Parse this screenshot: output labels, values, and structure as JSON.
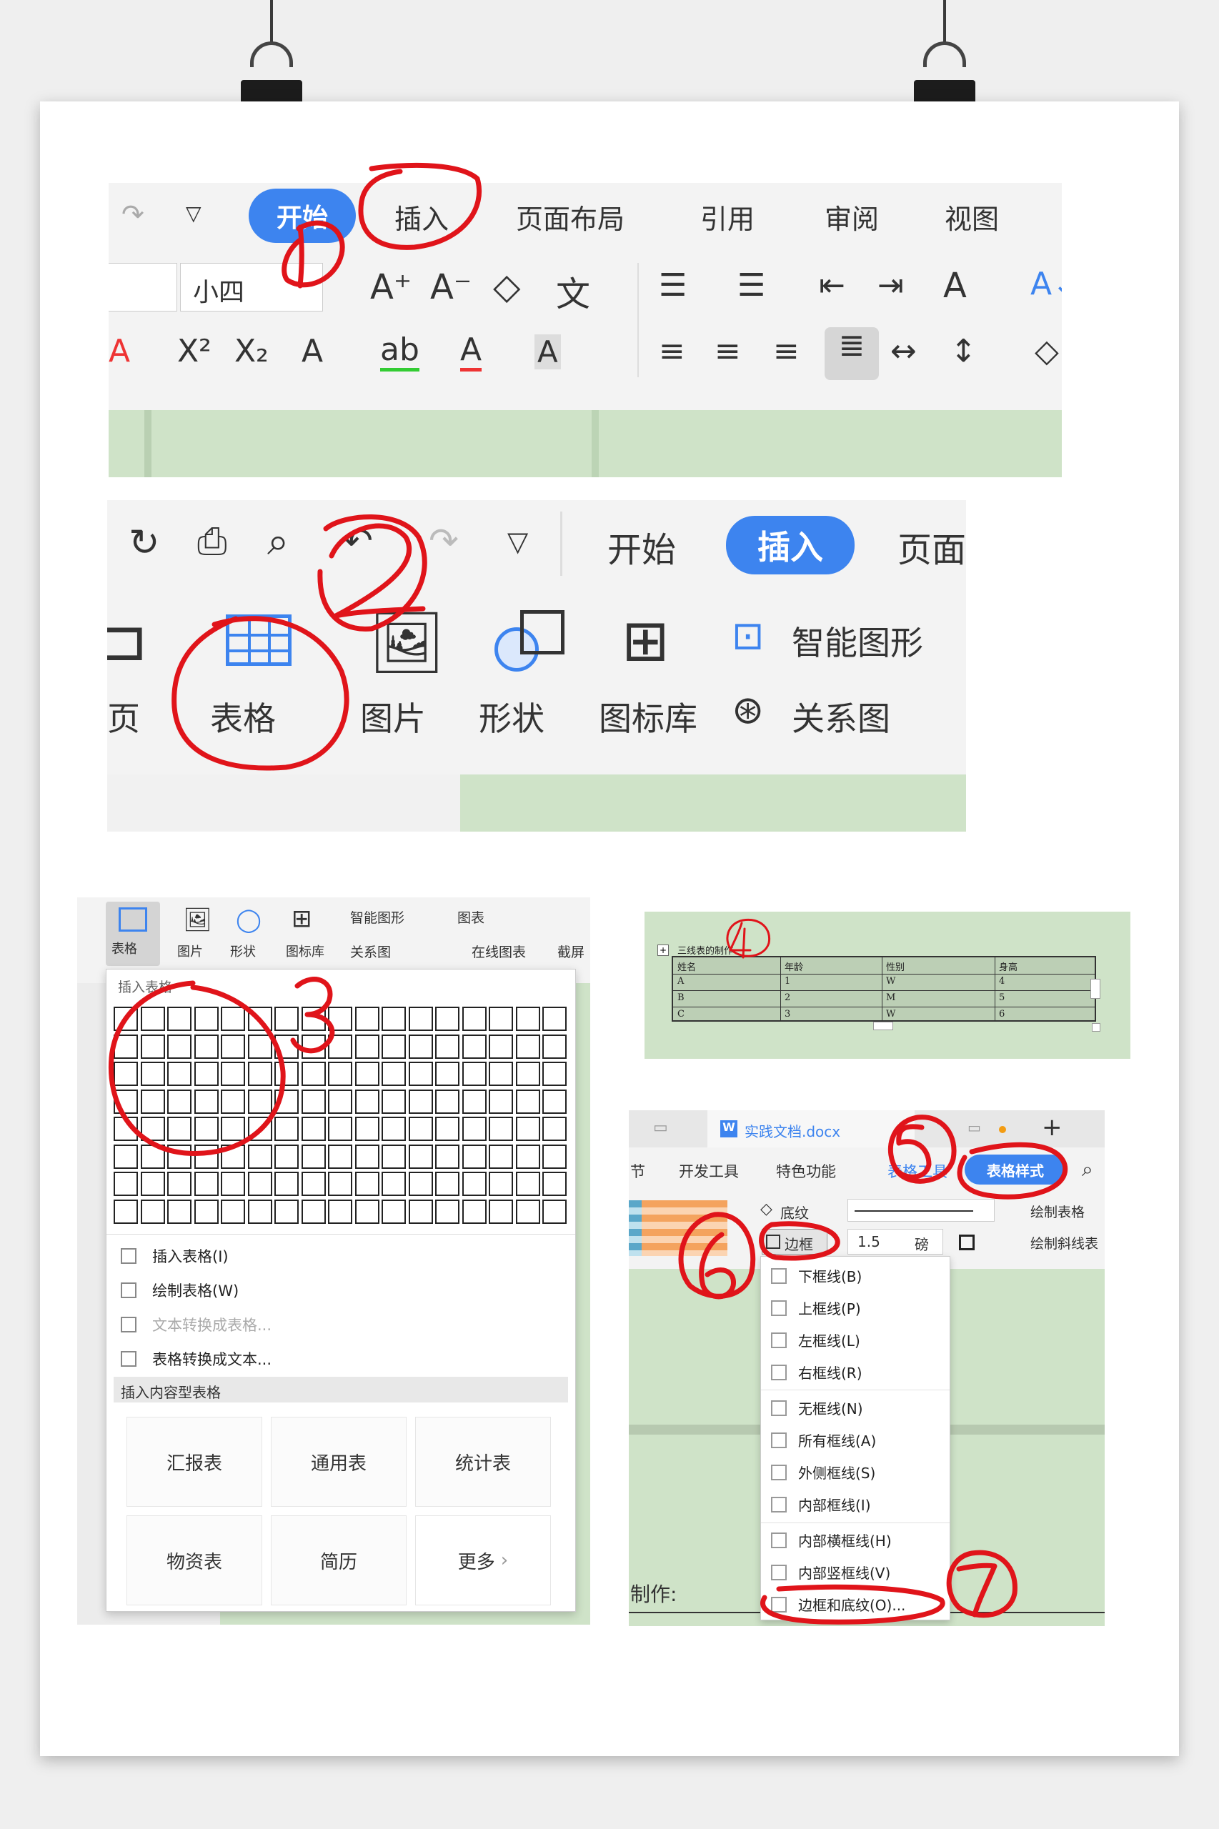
{
  "step1": {
    "tabs": [
      "开始",
      "插入",
      "页面布局",
      "引用",
      "审阅",
      "视图"
    ],
    "font_size": "小四",
    "markers": [
      "1"
    ]
  },
  "step2": {
    "tabs": [
      "开始",
      "插入",
      "页面"
    ],
    "buttons": [
      "表格",
      "图片",
      "形状",
      "图标库"
    ],
    "side_buttons": [
      "智能图形",
      "关系图"
    ],
    "left_fragment": "页",
    "marker": "2"
  },
  "step3": {
    "toolbar": [
      "表格",
      "图片",
      "形状",
      "图标库",
      "智能图形",
      "图表",
      "关系图",
      "在线图表",
      "截屏"
    ],
    "menu_title": "插入表格",
    "menu_items": [
      "插入表格(I)",
      "绘制表格(W)",
      "文本转换成表格...",
      "表格转换成文本..."
    ],
    "section_title": "插入内容型表格",
    "cards": [
      "汇报表",
      "通用表",
      "统计表",
      "物资表",
      "简历",
      "更多"
    ],
    "marker": "3"
  },
  "step4": {
    "caption": "三线表的制作",
    "headers": [
      "姓名",
      "年龄",
      "性别",
      "身高"
    ],
    "rows": [
      [
        "A",
        "1",
        "W",
        "4"
      ],
      [
        "B",
        "2",
        "M",
        "5"
      ],
      [
        "C",
        "3",
        "W",
        "6"
      ]
    ],
    "marker": "4"
  },
  "step5": {
    "doc_tab": "实践文档.docx",
    "ribbon": [
      "节",
      "开发工具",
      "特色功能",
      "表格工具",
      "表格样式"
    ],
    "shading": "底纹",
    "border_button": "边框",
    "line_width": "1.5",
    "unit": "磅",
    "draw_table": "绘制表格",
    "draw_diag": "绘制斜线表",
    "border_menu": [
      "下框线(B)",
      "上框线(P)",
      "左框线(L)",
      "右框线(R)",
      "无框线(N)",
      "所有框线(A)",
      "外侧框线(S)",
      "内部框线(I)",
      "内部横框线(H)",
      "内部竖框线(V)",
      "边框和底纹(O)..."
    ],
    "bottom_label": "制作:",
    "markers": [
      "5",
      "6",
      "7"
    ]
  },
  "colors": {
    "accent": "#3d84ef",
    "marker": "#e0141a",
    "doc_green": "#cfe3c8"
  }
}
